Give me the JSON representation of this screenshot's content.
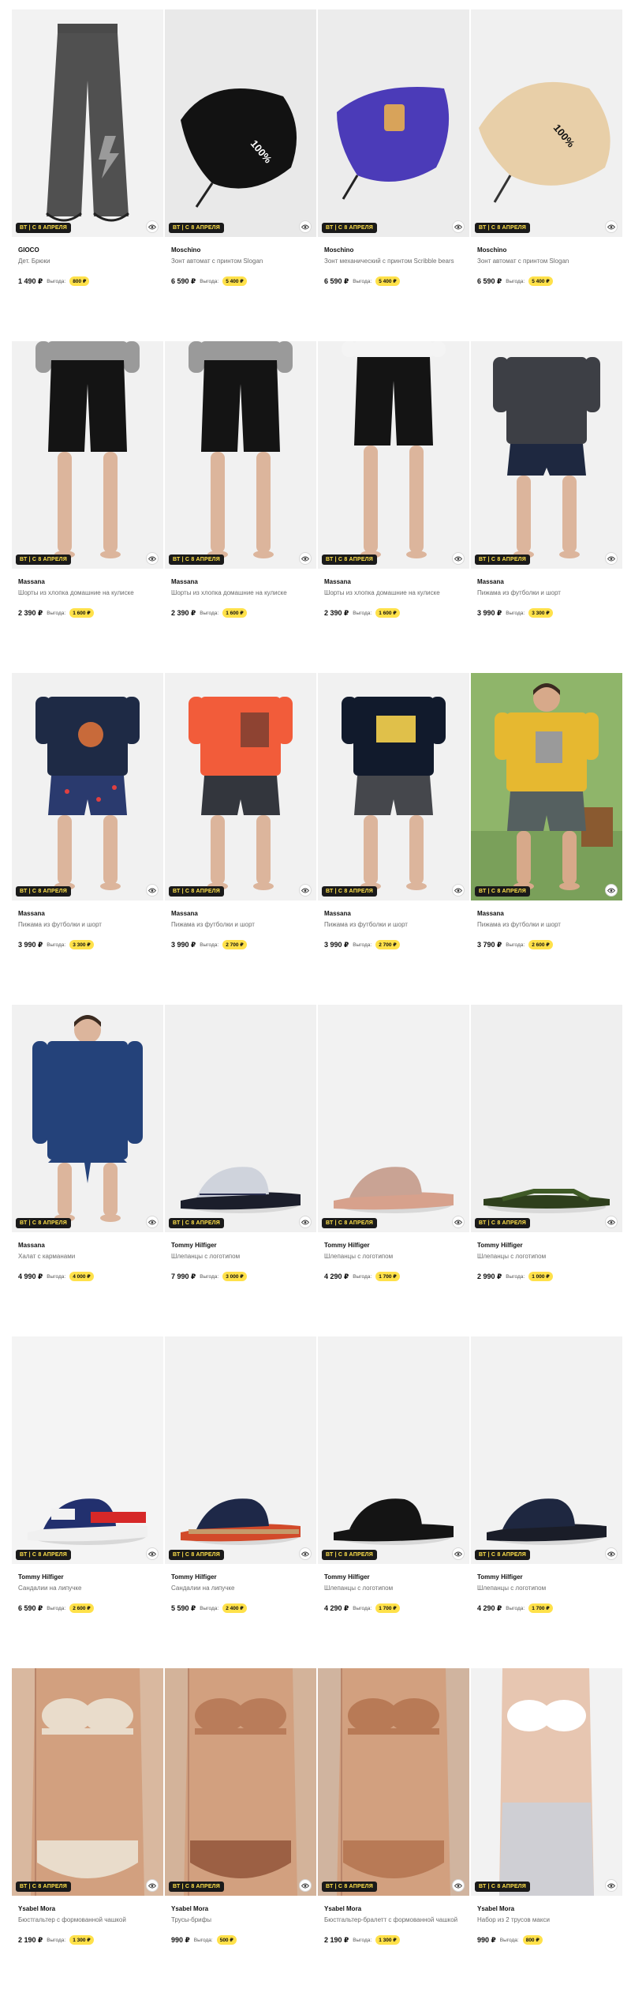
{
  "promo_badge": "ВТ | С 8 АПРЕЛЯ",
  "savings_label": "Выгода:",
  "products": [
    {
      "brand": "GIOCO",
      "title": "Дет. Брюки",
      "price": "1 490 ₽",
      "savings": "800 ₽",
      "art": "pants"
    },
    {
      "brand": "Moschino",
      "title": "Зонт автомат с принтом Slogan",
      "price": "6 590 ₽",
      "savings": "5 400 ₽",
      "art": "umbrella-black"
    },
    {
      "brand": "Moschino",
      "title": "Зонт механический с принтом Scribble bears",
      "price": "6 590 ₽",
      "savings": "5 400 ₽",
      "art": "umbrella-purple"
    },
    {
      "brand": "Moschino",
      "title": "Зонт автомат с принтом Slogan",
      "price": "6 590 ₽",
      "savings": "5 400 ₽",
      "art": "umbrella-beige"
    },
    {
      "brand": "Massana",
      "title": "Шорты из хлопка домашние на кулиске",
      "price": "2 390 ₽",
      "savings": "1 600 ₽",
      "art": "shorts"
    },
    {
      "brand": "Massana",
      "title": "Шорты из хлопка домашние на кулиске",
      "price": "2 390 ₽",
      "savings": "1 600 ₽",
      "art": "shorts"
    },
    {
      "brand": "Massana",
      "title": "Шорты из хлопка домашние на кулиске",
      "price": "2 390 ₽",
      "savings": "1 600 ₽",
      "art": "shorts-white"
    },
    {
      "brand": "Massana",
      "title": "Пижама из футболки и шорт",
      "price": "3 990 ₽",
      "savings": "3 300 ₽",
      "art": "pajama-grey"
    },
    {
      "brand": "Massana",
      "title": "Пижама из футболки и шорт",
      "price": "3 990 ₽",
      "savings": "3 300 ₽",
      "art": "pajama-navy"
    },
    {
      "brand": "Massana",
      "title": "Пижама из футболки и шорт",
      "price": "3 990 ₽",
      "savings": "2 700 ₽",
      "art": "pajama-orange"
    },
    {
      "brand": "Massana",
      "title": "Пижама из футболки и шорт",
      "price": "3 990 ₽",
      "savings": "2 700 ₽",
      "art": "pajama-black"
    },
    {
      "brand": "Massana",
      "title": "Пижама из футболки и шорт",
      "price": "3 790 ₽",
      "savings": "2 600 ₽",
      "art": "pajama-yellow"
    },
    {
      "brand": "Massana",
      "title": "Халат с карманами",
      "price": "4 990 ₽",
      "savings": "4 000 ₽",
      "art": "robe"
    },
    {
      "brand": "Tommy Hilfiger",
      "title": "Шлепанцы с логотипом",
      "price": "7 990 ₽",
      "savings": "3 000 ₽",
      "art": "slide-pattern"
    },
    {
      "brand": "Tommy Hilfiger",
      "title": "Шлепанцы с логотипом",
      "price": "4 290 ₽",
      "savings": "1 700 ₽",
      "art": "slide-pink"
    },
    {
      "brand": "Tommy Hilfiger",
      "title": "Шлепанцы с логотипом",
      "price": "2 990 ₽",
      "savings": "1 000 ₽",
      "art": "flipflop"
    },
    {
      "brand": "Tommy Hilfiger",
      "title": "Сандалии на липучке",
      "price": "6 590 ₽",
      "savings": "2 600 ₽",
      "art": "sandal-sport"
    },
    {
      "brand": "Tommy Hilfiger",
      "title": "Сандалии на липучке",
      "price": "5 590 ₽",
      "savings": "2 400 ₽",
      "art": "sandal-buckle"
    },
    {
      "brand": "Tommy Hilfiger",
      "title": "Шлепанцы с логотипом",
      "price": "4 290 ₽",
      "savings": "1 700 ₽",
      "art": "slide-black"
    },
    {
      "brand": "Tommy Hilfiger",
      "title": "Шлепанцы с логотипом",
      "price": "4 290 ₽",
      "savings": "1 700 ₽",
      "art": "slide-navy"
    },
    {
      "brand": "Ysabel Mora",
      "title": "Бюстгальтер с формованной чашкой",
      "price": "2 190 ₽",
      "savings": "1 300 ₽",
      "art": "bra-beige"
    },
    {
      "brand": "Ysabel Mora",
      "title": "Трусы-брифы",
      "price": "990 ₽",
      "savings": "500 ₽",
      "art": "briefs"
    },
    {
      "brand": "Ysabel Mora",
      "title": "Бюстгальтер-бралетт с формованной чашкой",
      "price": "2 190 ₽",
      "savings": "1 300 ₽",
      "art": "bralette"
    },
    {
      "brand": "Ysabel Mora",
      "title": "Набор из 2 трусов макси",
      "price": "990 ₽",
      "savings": "800 ₽",
      "art": "maxi"
    }
  ]
}
